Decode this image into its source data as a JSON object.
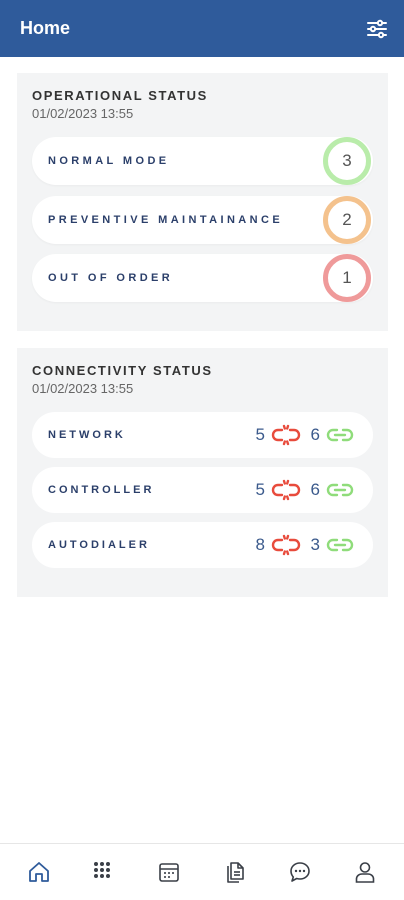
{
  "header": {
    "title": "Home",
    "filter_icon": "sliders-icon"
  },
  "operational": {
    "title": "OPERATIONAL STATUS",
    "timestamp": "01/02/2023 13:55",
    "items": [
      {
        "label": "NORMAL MODE",
        "count": "3",
        "color": "#b9ecaa"
      },
      {
        "label": "PREVENTIVE MAINTAINANCE",
        "count": "2",
        "color": "#f4c28d"
      },
      {
        "label": "OUT OF ORDER",
        "count": "1",
        "color": "#ef9a9a"
      }
    ]
  },
  "connectivity": {
    "title": "CONNECTIVITY STATUS",
    "timestamp": "01/02/2023 13:55",
    "broken_color": "#e84b3c",
    "linked_color": "#8fdc7a",
    "items": [
      {
        "label": "NETWORK",
        "disconnected": "5",
        "connected": "6"
      },
      {
        "label": "CONTROLLER",
        "disconnected": "5",
        "connected": "6"
      },
      {
        "label": "AUTODIALER",
        "disconnected": "8",
        "connected": "3"
      }
    ]
  },
  "bottom_nav": {
    "accent": "#2f5b9b",
    "items": [
      {
        "icon": "home-icon",
        "active": true
      },
      {
        "icon": "grid-icon",
        "active": false
      },
      {
        "icon": "calendar-icon",
        "active": false
      },
      {
        "icon": "documents-icon",
        "active": false
      },
      {
        "icon": "chat-icon",
        "active": false
      },
      {
        "icon": "user-icon",
        "active": false
      }
    ]
  }
}
